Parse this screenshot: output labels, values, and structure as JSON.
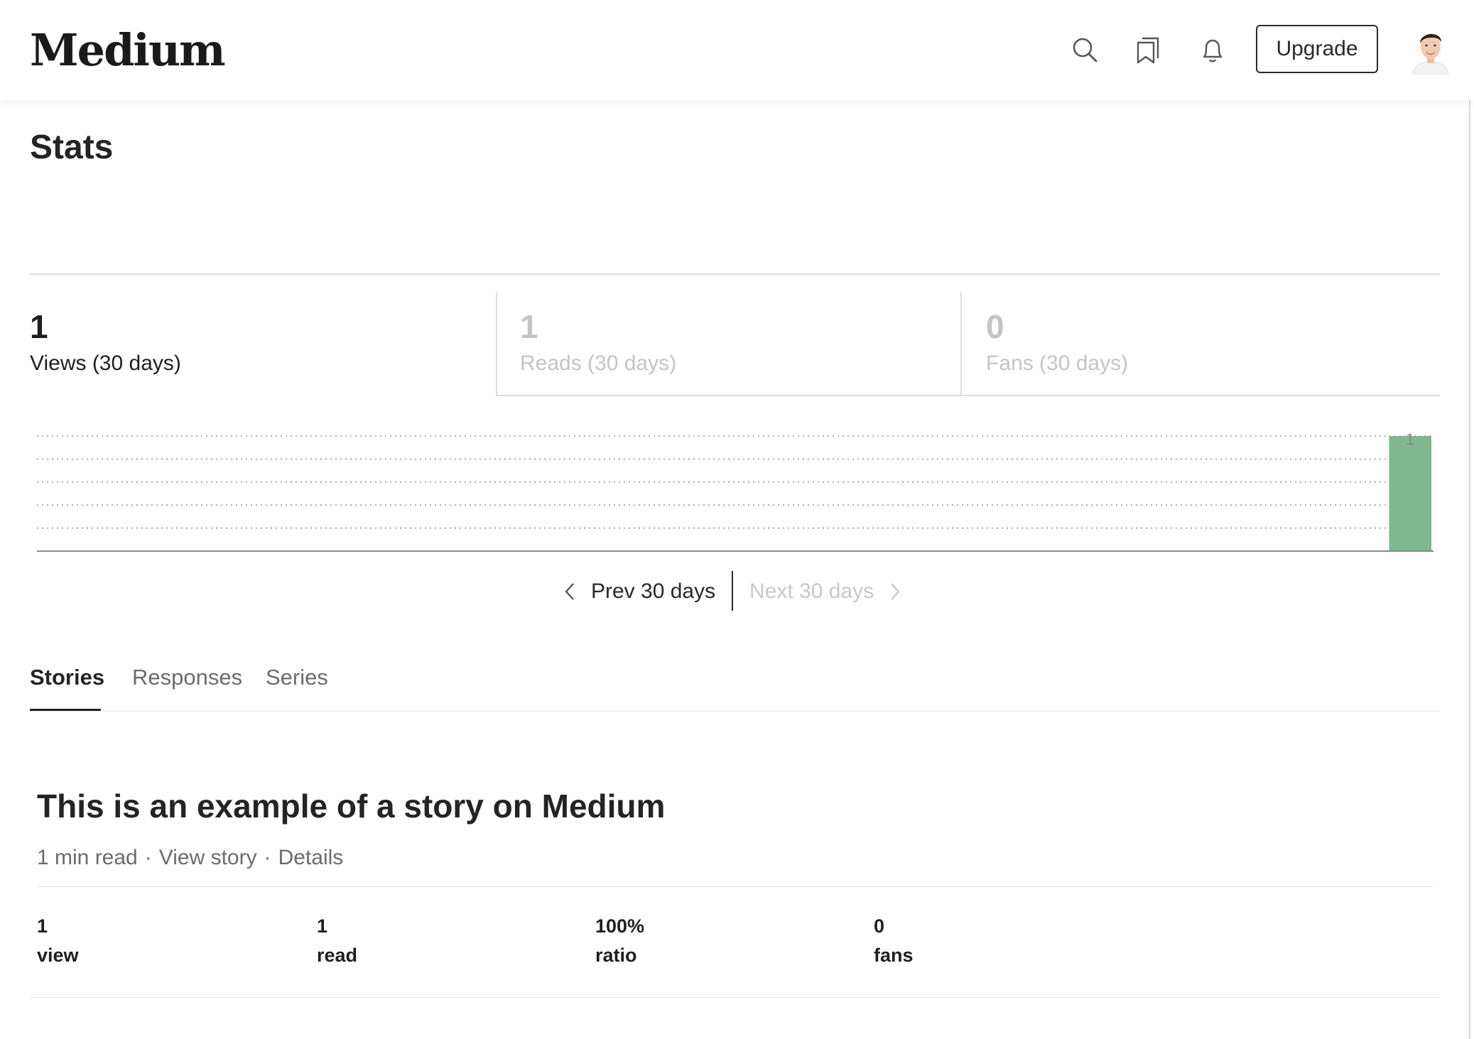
{
  "header": {
    "logo": "Medium",
    "upgrade_label": "Upgrade",
    "icons": [
      "search-icon",
      "bookmarks-icon",
      "notifications-bell-icon"
    ]
  },
  "page": {
    "title": "Stats"
  },
  "summary": [
    {
      "value": "1",
      "label": "Views (30 days)",
      "active": true
    },
    {
      "value": "1",
      "label": "Reads (30 days)",
      "active": false
    },
    {
      "value": "0",
      "label": "Fans (30 days)",
      "active": false
    }
  ],
  "chart_data": {
    "type": "bar",
    "days": 30,
    "values": [
      0,
      0,
      0,
      0,
      0,
      0,
      0,
      0,
      0,
      0,
      0,
      0,
      0,
      0,
      0,
      0,
      0,
      0,
      0,
      0,
      0,
      0,
      0,
      0,
      0,
      0,
      0,
      0,
      0,
      1
    ],
    "ylim": [
      0,
      1
    ],
    "top_tick_label": "1",
    "grid": true,
    "bar_color": "#7fb78f"
  },
  "pager": {
    "prev_label": "Prev 30 days",
    "next_label": "Next 30 days"
  },
  "tabs": {
    "stories": "Stories",
    "responses": "Responses",
    "series": "Series"
  },
  "story": {
    "title": "This is an example of a story on Medium",
    "read_time": "1 min read",
    "view_story": "View story",
    "details": "Details",
    "separator": "·",
    "metrics": [
      {
        "value": "1",
        "label": "view"
      },
      {
        "value": "1",
        "label": "read"
      },
      {
        "value": "100%",
        "label": "ratio"
      },
      {
        "value": "0",
        "label": "fans"
      }
    ]
  }
}
